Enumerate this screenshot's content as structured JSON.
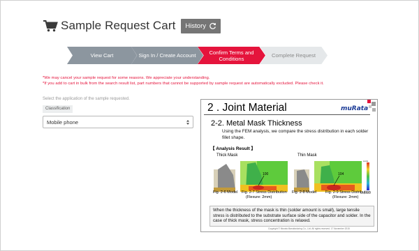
{
  "header": {
    "title": "Sample Request Cart",
    "history_label": "History",
    "cart_icon": "cart-icon",
    "history_icon": "refresh-icon"
  },
  "steps": [
    {
      "label": "View Cart",
      "state": "done"
    },
    {
      "label": "Sign In / Create Account",
      "state": "done"
    },
    {
      "label": "Confirm Terms and Conditions",
      "state": "current"
    },
    {
      "label": "Complete Request",
      "state": "upcoming"
    }
  ],
  "notices": [
    "*We may cancel your sample request for some reasons. We appreciate your understanding.",
    "*If you add to cart in bulk from the search result list, part numbers that cannot be supported by sample request are automatically excluded. Please check it."
  ],
  "application": {
    "prompt": "Select the application of the sample requested.",
    "classification_label": "Classification",
    "selected": "Mobile phone"
  },
  "slide": {
    "title": "2 . Joint Material",
    "brand": "muRata",
    "subtitle": "2-2. Metal Mask Thickness",
    "description": "Using the FEM analysis, we compare the stress distribution in each solder fillet shape.",
    "analysis_heading": "【 Analysis Result 】",
    "thick_mask": "Thick Mask",
    "thin_mask": "Thin Mask",
    "value_thick": "100",
    "value_thin": "104",
    "legend_top": "tensile",
    "legend_bottom": "Compression",
    "fig_26": "Fig. 2-6 Model",
    "fig_27a": "Fig. 2-7 Stress Distribution",
    "fig_27b": "(Flexure: 2mm)",
    "fig_28": "Fig. 2-8 Model",
    "fig_29a": "Fig. 2-9  Stress Distribution",
    "fig_29b": "(Flexure: 2mm)",
    "note": "When the thickness of the mask is thin (solder amount is small), large tensile stress is distributed to the substrate surface side of the capacitor and solder. In the case of thick mask, stress concentration is relaxed.",
    "copyright": "Copyright © Murata Manufacturing Co., Ltd. All rights reserved.    17 November 2015"
  },
  "colors": {
    "accent_red": "#e5143c",
    "step_gray": "#8c969f",
    "step_light": "#e5e8ea",
    "history_bg": "#757575",
    "brand_blue": "#1a3a96"
  }
}
